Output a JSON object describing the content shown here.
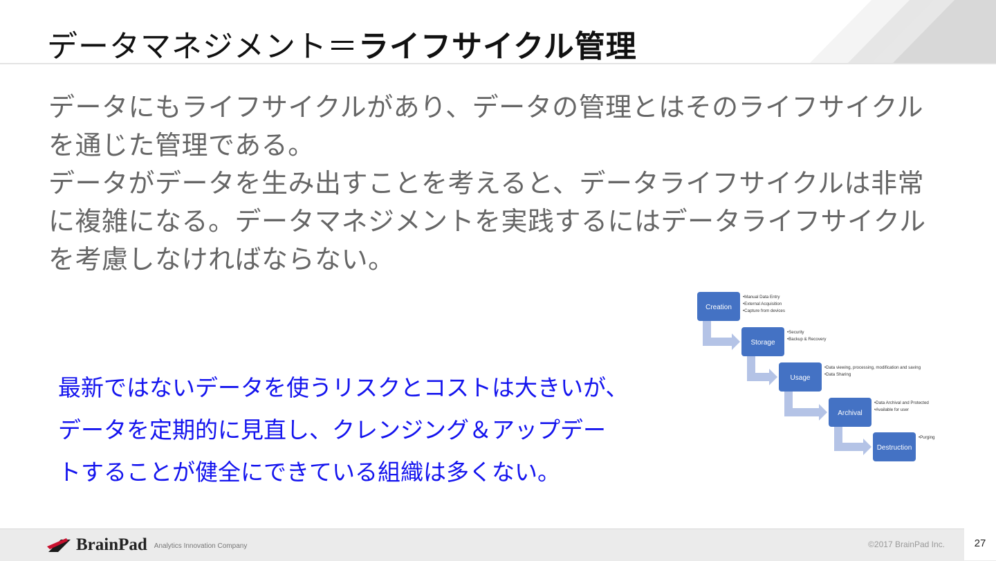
{
  "slide": {
    "title_plain": "データマネジメント＝",
    "title_bold": "ライフサイクル管理",
    "paragraphs": [
      "データにもライフサイクルがあり、データの管理とはそのライフサイクルを通じた管理である。",
      "データがデータを生み出すことを考えると、データライフサイクルは非常に複雑になる。データマネジメントを実践するにはデータライフサイクルを考慮しなければならない。"
    ],
    "callout_lines": [
      "最新ではないデータを使うリスクとコストは大きいが、",
      "データを定期的に見直し、クレンジング＆アップデー",
      "トすることが健全にできている組織は多くない。"
    ],
    "callout_color": "#1414ee"
  },
  "diagram": {
    "stages": [
      {
        "label": "Creation",
        "notes": [
          "•Manual Data Entry",
          "•External Acquisition",
          "•Capture from devices"
        ]
      },
      {
        "label": "Storage",
        "notes": [
          "•Security",
          "•Backup & Recovery"
        ]
      },
      {
        "label": "Usage",
        "notes": [
          "•Data viewing, processing, modification and saving",
          "•Data Sharing"
        ]
      },
      {
        "label": "Archival",
        "notes": [
          "•Data Archival and Protected",
          "•Available for user"
        ]
      },
      {
        "label": "Destruction",
        "notes": [
          "•Purging"
        ]
      }
    ],
    "box_color": "#4472c4",
    "arrow_color": "#b4c3e6"
  },
  "footer": {
    "logo_text": "BrainPad",
    "tagline": "Analytics Innovation Company",
    "copyright": "©2017 BrainPad Inc.",
    "page_number": "27"
  }
}
